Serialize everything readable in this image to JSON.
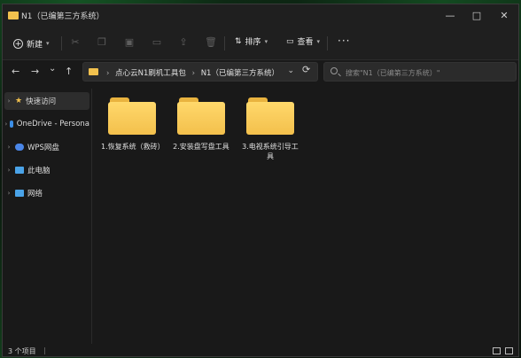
{
  "window": {
    "title": "N1（已编第三方系统）",
    "minimize": "—",
    "maximize": "□",
    "close": "✕"
  },
  "toolbar": {
    "new_label": "新建",
    "sort_label": "排序",
    "view_label": "查看",
    "more": "···",
    "icons": [
      "cut-icon",
      "copy-icon",
      "paste-icon",
      "rename-icon",
      "share-icon",
      "delete-icon"
    ]
  },
  "address": {
    "back": "←",
    "forward": "→",
    "recent": "⌄",
    "up": "↑",
    "crumbs": [
      "点心云N1刷机工具包",
      "N1（已编第三方系统）"
    ],
    "refresh": "⟳",
    "search_placeholder": "搜索\"N1（已编第三方系统）\""
  },
  "sidebar": {
    "items": [
      {
        "label": "快速访问",
        "icon": "star-icon",
        "color": "#f2c14e"
      },
      {
        "label": "OneDrive - Persona",
        "icon": "cloud-icon",
        "color": "#3c8ee6"
      },
      {
        "label": "WPS网盘",
        "icon": "cloud-icon",
        "color": "#4a86e8"
      },
      {
        "label": "此电脑",
        "icon": "computer-icon",
        "color": "#4aa3e8"
      },
      {
        "label": "网络",
        "icon": "network-icon",
        "color": "#4aa3e8"
      }
    ]
  },
  "files": [
    {
      "name": "1.恢复系统（救砖）"
    },
    {
      "name": "2.安装盘写盘工具"
    },
    {
      "name": "3.电视系统引导工具"
    }
  ],
  "status": {
    "count": "3 个项目",
    "sep": "|"
  },
  "colors": {
    "folder": "#f3c04c",
    "background": "#191919"
  }
}
